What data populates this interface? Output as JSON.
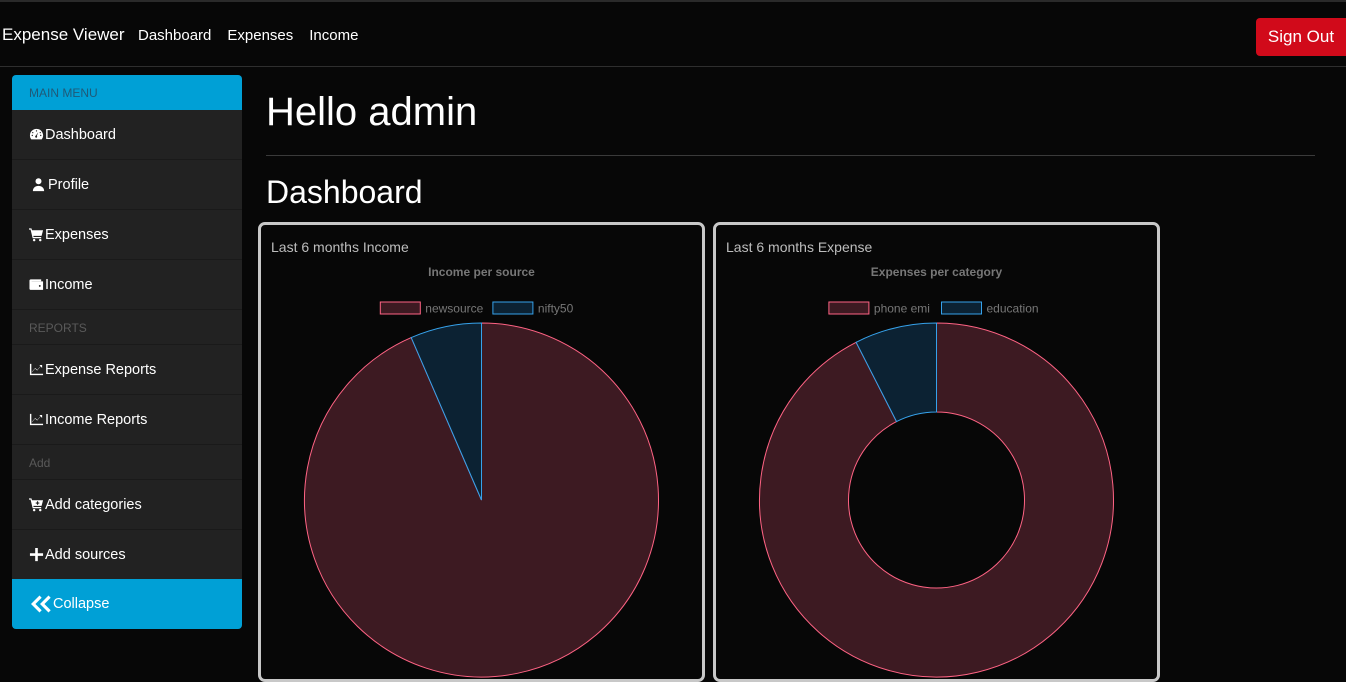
{
  "nav": {
    "brand": "Expense Viewer",
    "links": [
      "Dashboard",
      "Expenses",
      "Income"
    ],
    "signout": "Sign Out"
  },
  "sidebar": {
    "main_menu": "MAIN MENU",
    "items": [
      {
        "label": "Dashboard",
        "icon": "speedometer-icon"
      },
      {
        "label": "Profile",
        "icon": "user-icon"
      },
      {
        "label": "Expenses",
        "icon": "cart-icon"
      },
      {
        "label": "Income",
        "icon": "wallet-icon"
      }
    ],
    "reports_header": "REPORTS",
    "reports": [
      {
        "label": "Expense Reports",
        "icon": "chart-line-icon"
      },
      {
        "label": "Income Reports",
        "icon": "chart-line-icon"
      }
    ],
    "add_header": "Add",
    "add": [
      {
        "label": "Add categories",
        "icon": "cart-plus-icon"
      },
      {
        "label": "Add sources",
        "icon": "plus-icon"
      }
    ],
    "collapse": "Collapse"
  },
  "main": {
    "greeting": "Hello admin",
    "title": "Dashboard"
  },
  "colors": {
    "slice1_fill": "#3d1a22",
    "slice1_stroke": "#ff6384",
    "slice2_fill": "#0c2233",
    "slice2_stroke": "#36a2eb",
    "accent": "#00a0d6",
    "danger": "#d10a1a"
  },
  "chart_data": [
    {
      "type": "pie",
      "card_title": "Last 6 months Income",
      "title": "Income per source",
      "labels": [
        "newsource",
        "nifty50"
      ],
      "values": [
        93.5,
        6.5
      ]
    },
    {
      "type": "doughnut",
      "card_title": "Last 6 months Expense",
      "title": "Expenses per category",
      "labels": [
        "phone emi",
        "education"
      ],
      "values": [
        92.5,
        7.5
      ]
    }
  ]
}
